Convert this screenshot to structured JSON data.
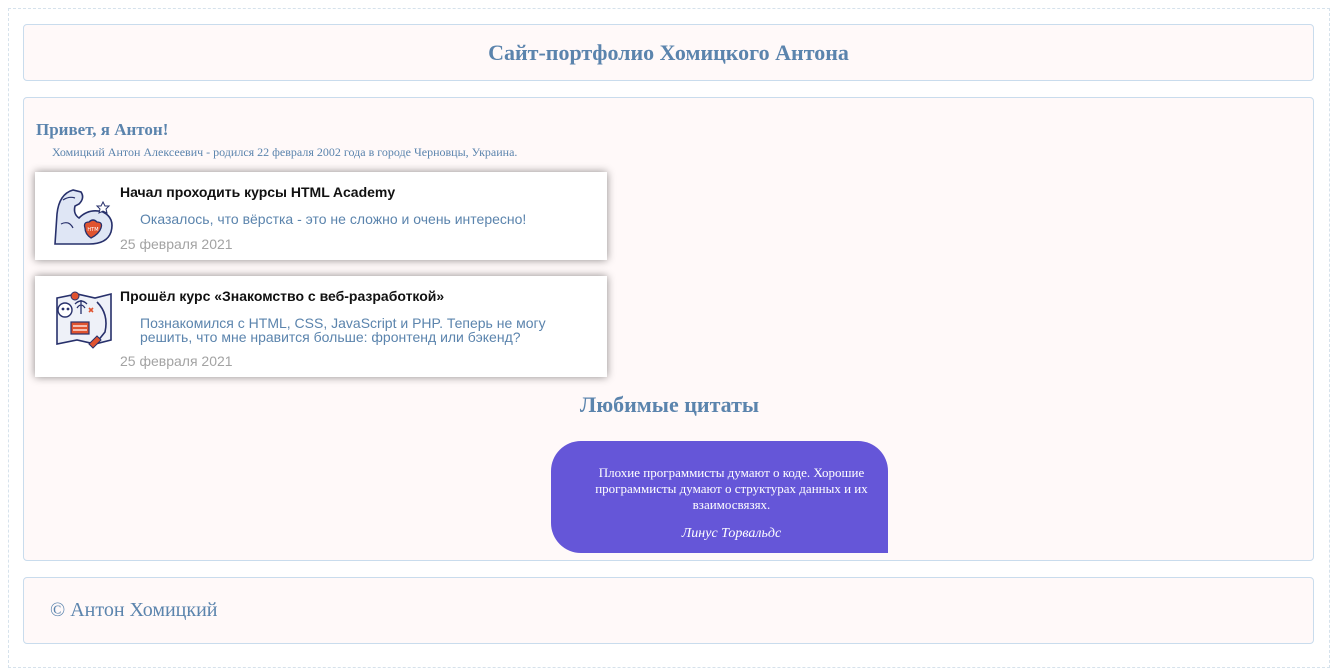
{
  "header": {
    "title": "Сайт-портфолио Хомицкого Антона"
  },
  "intro": {
    "greeting": "Привет, я Антон!",
    "bio": "Хомицкий Антон Алексеевич - родился 22 февраля 2002 года в городе Черновцы, Украина."
  },
  "posts": [
    {
      "title": "Начал проходить курсы HTML Academy",
      "text": "Оказалось, что вёрстка - это не сложно и очень интересно!",
      "date": "25 февраля 2021",
      "icon": "muscle-arm-icon"
    },
    {
      "title": "Прошёл курс «Знакомство с веб-разработкой»",
      "text": "Познакомился с HTML, CSS, JavaScript и PHP. Теперь не могу решить, что мне нравится больше: фронтенд или бэкенд?",
      "date": "25 февраля 2021",
      "icon": "treasure-map-icon"
    }
  ],
  "quotes": {
    "title": "Любимые цитаты",
    "items": [
      {
        "text": "Плохие программисты думают о коде. Хорошие программисты думают о структурах данных и их взаимосвязях.",
        "author": "Линус Торвальдс"
      }
    ]
  },
  "footer": {
    "copyright": "© Антон Хомицкий"
  },
  "colors": {
    "accent": "#5b84ad",
    "panel_bg": "#fff9f9",
    "panel_border": "#c9dced",
    "quote_bg": "#6556d8",
    "date": "#a3a3a3"
  }
}
